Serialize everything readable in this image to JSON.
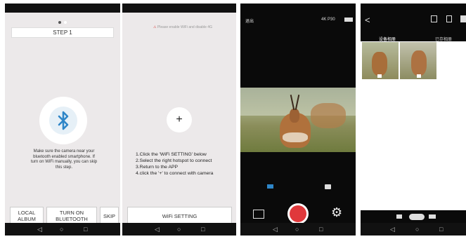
{
  "screen1": {
    "step_label": "STEP 1",
    "hint": "Make sure the camera near your bluetooth enabled smartphone. If turn on WiFi manually, you can skip this step.",
    "buttons": [
      "LOCAL ALBUM",
      "TURN ON BLUETOOTH",
      "SKIP"
    ]
  },
  "screen2": {
    "notice": "Please enable WiFi and disable 4G",
    "plus": "+",
    "instructions": [
      "1.Click the 'WiFi SETTING' below",
      "2.Select the right hotspot to connect",
      "3.Return to the APP",
      "4.click the '+' to connect with camera"
    ],
    "wifi_button": "WiFi SETTING"
  },
  "screen3": {
    "exit_label": "退出",
    "resolution": "4K P30"
  },
  "screen4": {
    "tab_device": "设备相册",
    "tab_saved": "已存相册"
  },
  "icons": [
    "back-icon",
    "recent-apps-icon",
    "home-icon",
    "bluetooth-icon",
    "battery-icon",
    "video-icon",
    "camera-icon",
    "gallery-icon",
    "shutter-icon",
    "settings-icon",
    "download-icon",
    "delete-icon"
  ],
  "colors": {
    "accent": "#2e86c8",
    "shutter": "#e0383b",
    "background": "#ece9ea"
  }
}
